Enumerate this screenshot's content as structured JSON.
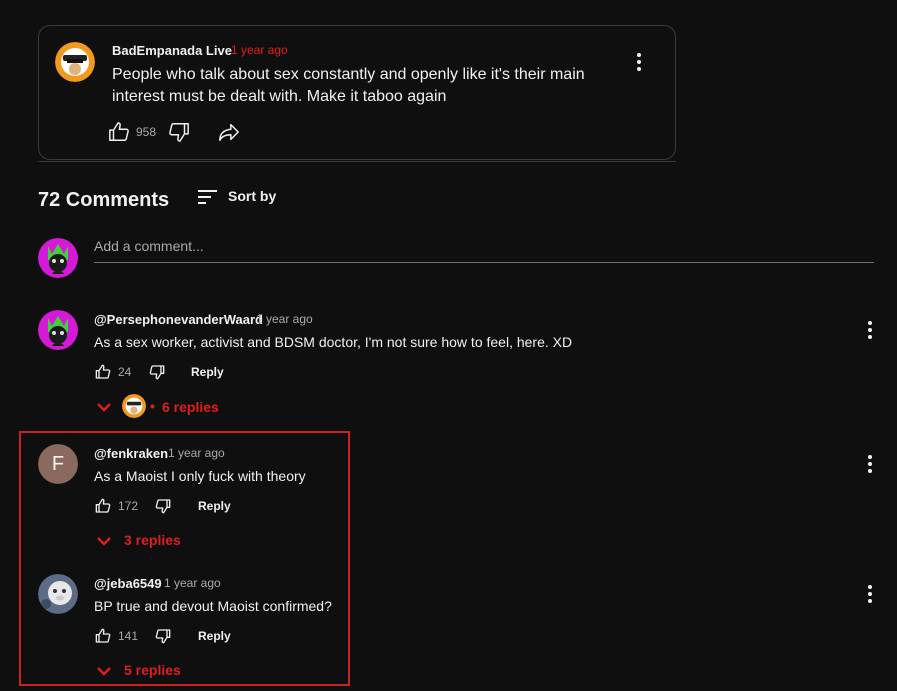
{
  "post": {
    "author": "BadEmpanada Live",
    "time": "1 year ago",
    "text": "People who talk about sex constantly and openly like it's their main interest must be dealt with. Make it taboo again",
    "likes": "958"
  },
  "comments_header": {
    "count_label": "72 Comments",
    "sort_label": "Sort by"
  },
  "add_comment": {
    "placeholder": "Add a comment..."
  },
  "comments": [
    {
      "author": "@PersephonevanderWaard",
      "time": "1 year ago",
      "text": "As a sex worker, activist and BDSM doctor, I'm not sure how to feel, here. XD",
      "likes": "24",
      "reply_label": "Reply",
      "replies_label": "6 replies",
      "replies_separator": "•"
    },
    {
      "author": "@fenkraken",
      "time": "1 year ago",
      "text": "As a Maoist I only fuck with theory",
      "likes": "172",
      "reply_label": "Reply",
      "replies_label": "3 replies",
      "avatar_letter": "F"
    },
    {
      "author": "@jeba6549",
      "time": "1 year ago",
      "text": "BP true and devout Maoist confirmed?",
      "likes": "141",
      "reply_label": "Reply",
      "replies_label": "5 replies"
    }
  ],
  "colors": {
    "background": "#0f0f0f",
    "accent_red": "#e01e1e",
    "highlight_box": "#c9221f",
    "text_primary": "#f1f1f1",
    "text_secondary": "#aaaaaa"
  },
  "icons": [
    "thumbs-up-icon",
    "thumbs-down-icon",
    "share-icon",
    "kebab-menu-icon",
    "sort-icon",
    "chevron-down-icon"
  ]
}
